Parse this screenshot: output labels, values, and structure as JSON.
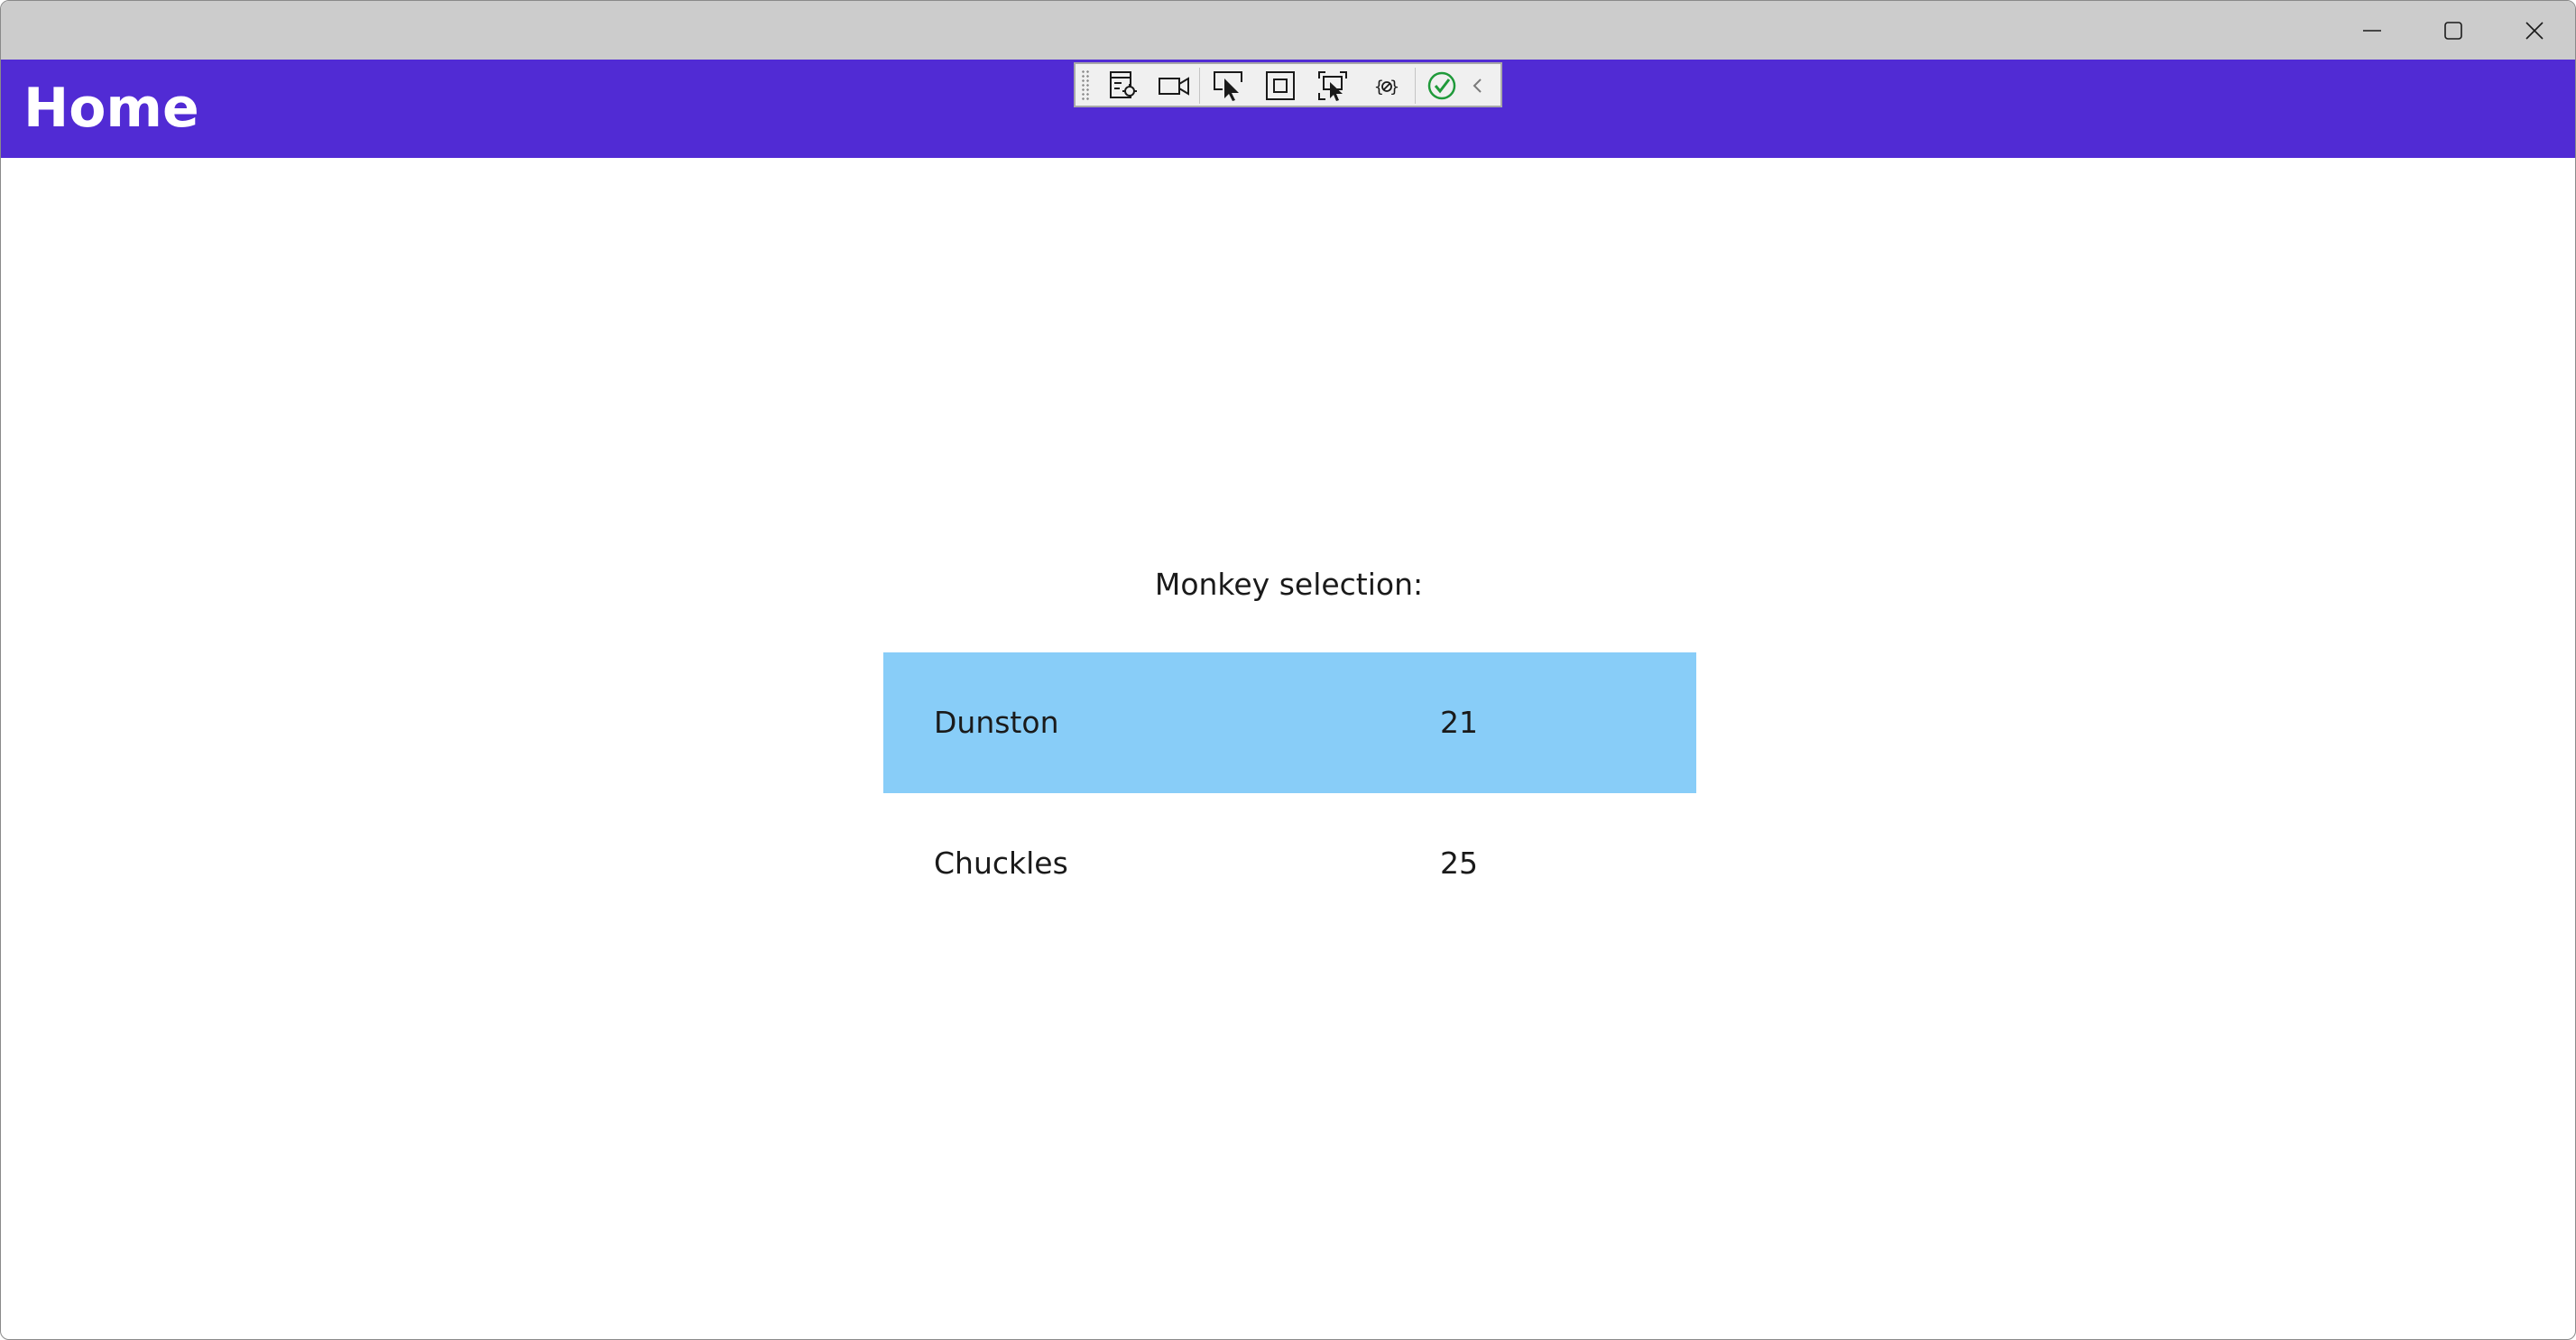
{
  "window": {
    "controls": {
      "minimize_icon": "minimize-icon",
      "maximize_icon": "maximize-icon",
      "close_icon": "close-icon"
    }
  },
  "appbar": {
    "title": "Home",
    "background": "#512bd4",
    "text_color": "#ffffff"
  },
  "dev_toolbar": {
    "buttons": [
      "live-visual-tree-icon",
      "video-camera-icon",
      "select-element-icon",
      "display-layout-adorners-icon",
      "track-focused-element-icon",
      "binding-failures-icon",
      "hot-reload-status-icon",
      "collapse-chevron-icon"
    ]
  },
  "main": {
    "label": "Monkey selection:",
    "selected_color": "#88cdf8",
    "items": [
      {
        "name": "Dunston",
        "age": "21",
        "selected": true
      },
      {
        "name": "Chuckles",
        "age": "25",
        "selected": false
      }
    ]
  }
}
